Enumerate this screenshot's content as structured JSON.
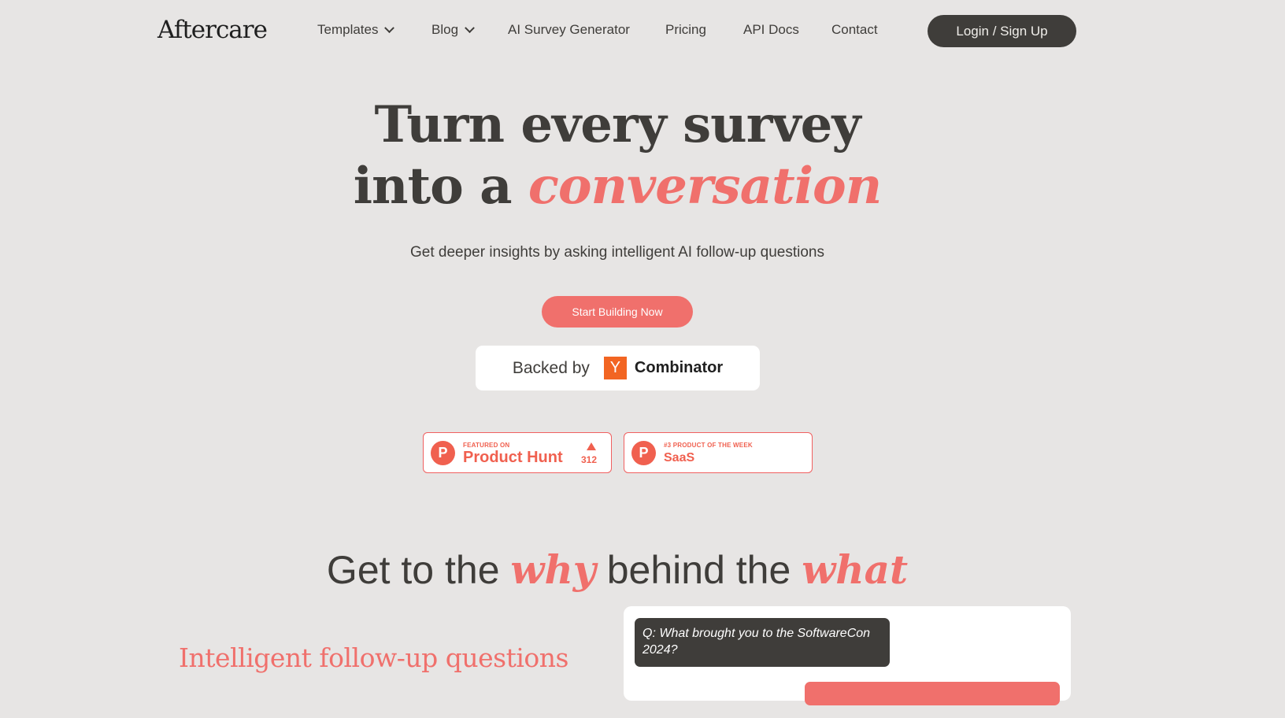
{
  "brand": {
    "logo": "Aftercare"
  },
  "nav": {
    "items": [
      {
        "label": "Templates",
        "dropdown": true
      },
      {
        "label": "Blog",
        "dropdown": true
      },
      {
        "label": "AI Survey Generator"
      },
      {
        "label": "Pricing"
      },
      {
        "label": "API Docs"
      },
      {
        "label": "Contact"
      }
    ],
    "login_label": "Login / Sign Up"
  },
  "hero": {
    "line1": "Turn every survey",
    "line2_prefix": "into a ",
    "line2_accent": "conversation",
    "subtitle": "Get deeper insights by asking intelligent AI follow-up questions",
    "cta_label": "Start Building Now"
  },
  "backed": {
    "label": "Backed by",
    "yc_letter": "Y",
    "yc_name": "Combinator"
  },
  "badges": [
    {
      "small": "FEATURED ON",
      "big": "Product Hunt",
      "upvotes": "312",
      "letter": "P"
    },
    {
      "small": "#3 PRODUCT OF THE WEEK",
      "big": "SaaS",
      "letter": "P"
    }
  ],
  "section": {
    "t1": "Get to the ",
    "t2": "why",
    "t3": " behind the ",
    "t4": "what"
  },
  "feature": {
    "title": "Intelligent follow-up questions"
  },
  "chat": {
    "question": "Q: What brought you to the SoftwareCon 2024?"
  },
  "colors": {
    "accent": "#f0706c",
    "dark": "#3f3d3a",
    "background": "#e7e5e4",
    "yc_orange": "#f26522"
  }
}
